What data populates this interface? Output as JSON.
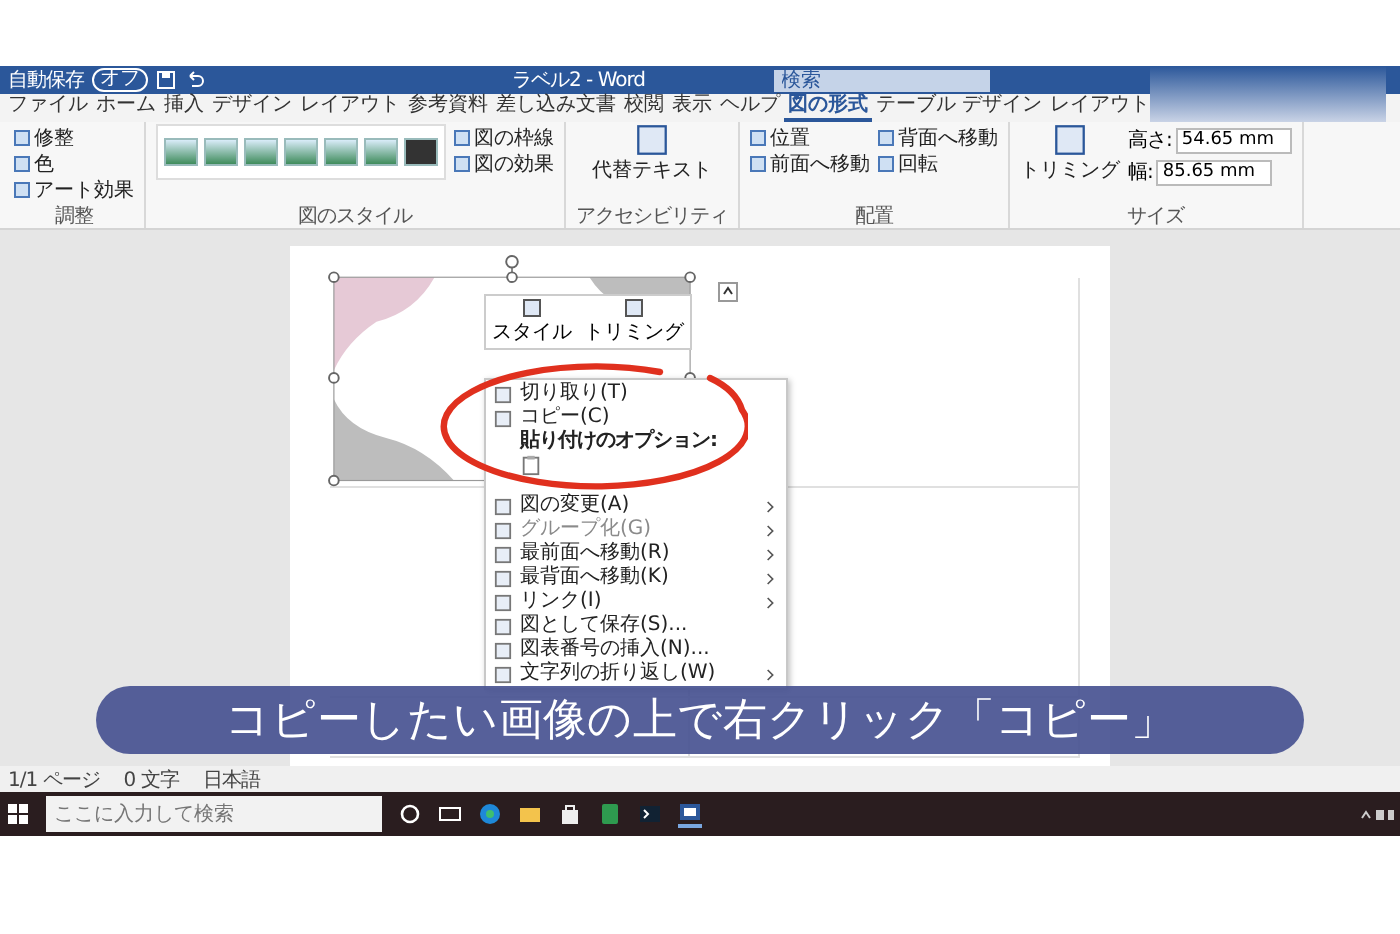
{
  "titlebar": {
    "autosave_label": "自動保存",
    "autosave_state": "オフ",
    "autosave_on": false,
    "title": "ラベル2 - Word",
    "search_placeholder": "検索"
  },
  "tabs": [
    {
      "label": "ファイル",
      "selected": false
    },
    {
      "label": "ホーム",
      "selected": false
    },
    {
      "label": "挿入",
      "selected": false
    },
    {
      "label": "デザイン",
      "selected": false
    },
    {
      "label": "レイアウト",
      "selected": false
    },
    {
      "label": "参考資料",
      "selected": false
    },
    {
      "label": "差し込み文書",
      "selected": false
    },
    {
      "label": "校閲",
      "selected": false
    },
    {
      "label": "表示",
      "selected": false
    },
    {
      "label": "ヘルプ",
      "selected": false
    },
    {
      "label": "図の形式",
      "selected": true
    },
    {
      "label": "テーブル デザイン",
      "selected": false
    },
    {
      "label": "レイアウト",
      "selected": false
    }
  ],
  "ribbon_groups": [
    {
      "label": "調整",
      "kind": "list",
      "columns": [
        [
          "修整",
          "色",
          "アート効果"
        ]
      ]
    },
    {
      "label": "図のスタイル",
      "kind": "gallery",
      "columns": [
        [
          "図の枠線",
          "図の効果"
        ]
      ]
    },
    {
      "label": "アクセシビリティ",
      "kind": "big",
      "big": "代替テキスト"
    },
    {
      "label": "配置",
      "kind": "list",
      "columns": [
        [
          "位置",
          "前面へ移動"
        ],
        [
          "背面へ移動",
          "回転"
        ]
      ]
    },
    {
      "label": "サイズ",
      "kind": "size",
      "big": "トリミング",
      "fields": [
        {
          "label": "高さ:",
          "value": "54.65 mm"
        },
        {
          "label": "幅:",
          "value": "85.65 mm"
        }
      ]
    }
  ],
  "mini_toolbar": [
    "スタイル",
    "トリミング"
  ],
  "context_menu": [
    {
      "kind": "item",
      "label": "切り取り(T)",
      "disabled": false,
      "submenu": false
    },
    {
      "kind": "item",
      "label": "コピー(C)",
      "disabled": false,
      "submenu": false
    },
    {
      "kind": "heading",
      "label": "貼り付けのオプション:"
    },
    {
      "kind": "paste"
    },
    {
      "kind": "item",
      "label": "図の変更(A)",
      "disabled": false,
      "submenu": true
    },
    {
      "kind": "item",
      "label": "グループ化(G)",
      "disabled": true,
      "submenu": true
    },
    {
      "kind": "item",
      "label": "最前面へ移動(R)",
      "disabled": false,
      "submenu": true
    },
    {
      "kind": "item",
      "label": "最背面へ移動(K)",
      "disabled": false,
      "submenu": true
    },
    {
      "kind": "item",
      "label": "リンク(I)",
      "disabled": false,
      "submenu": true
    },
    {
      "kind": "item",
      "label": "図として保存(S)...",
      "disabled": false,
      "submenu": false
    },
    {
      "kind": "item",
      "label": "図表番号の挿入(N)...",
      "disabled": false,
      "submenu": false
    },
    {
      "kind": "item",
      "label": "文字列の折り返し(W)",
      "disabled": false,
      "submenu": true
    }
  ],
  "caption": "コピーしたい画像の上で右クリック「コピー」",
  "status_bar": [
    "1/1 ページ",
    "0 文字",
    "日本語"
  ],
  "taskbar": {
    "search_placeholder": "ここに入力して検索"
  }
}
